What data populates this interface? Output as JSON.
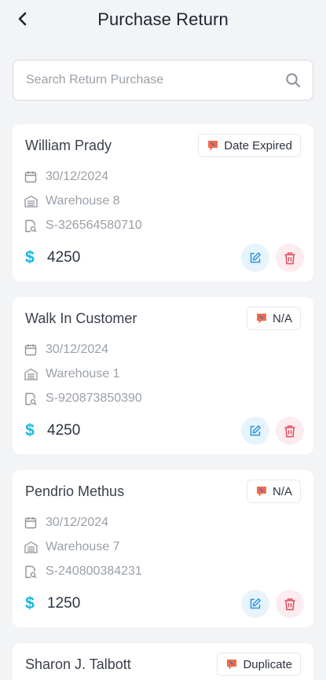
{
  "header": {
    "title": "Purchase Return"
  },
  "search": {
    "placeholder": "Search Return Purchase",
    "value": ""
  },
  "colors": {
    "accent": "#14b8e6",
    "edit": "#2a97e0",
    "delete": "#e34b5b",
    "badge": "#f26b4a"
  },
  "cards": [
    {
      "name": "William Prady",
      "status": "Date Expired",
      "date": "30/12/2024",
      "warehouse": "Warehouse 8",
      "reference": "S-326564580710",
      "currency_symbol": "$",
      "amount": "4250"
    },
    {
      "name": "Walk In Customer",
      "status": "N/A",
      "date": "30/12/2024",
      "warehouse": "Warehouse 1",
      "reference": "S-920873850390",
      "currency_symbol": "$",
      "amount": "4250"
    },
    {
      "name": "Pendrio Methus",
      "status": "N/A",
      "date": "30/12/2024",
      "warehouse": "Warehouse 7",
      "reference": "S-240800384231",
      "currency_symbol": "$",
      "amount": "1250"
    },
    {
      "name": "Sharon J. Talbott",
      "status": "Duplicate"
    }
  ]
}
